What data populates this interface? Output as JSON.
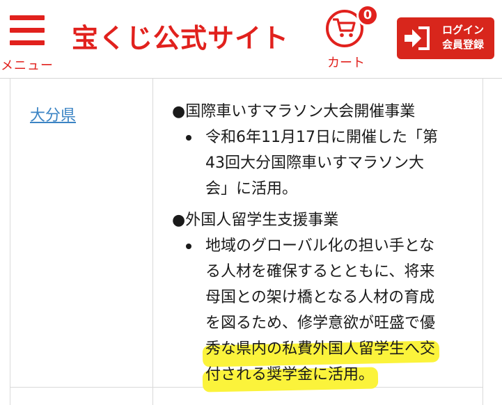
{
  "header": {
    "menu_label": "メニュー",
    "site_title": "宝くじ公式サイト",
    "cart_label": "カート",
    "cart_count": "0",
    "login_line1": "ログイン",
    "login_line2": "会員登録"
  },
  "row": {
    "prefecture": "大分県",
    "sections": [
      {
        "heading": "●国際車いすマラソン大会開催事業",
        "lines": [
          "令和6年11月17日に開催した「第",
          "43回大分国際車いすマラソン大",
          "会」に活用。"
        ]
      },
      {
        "heading": "●外国人留学生支援事業",
        "lines": [
          "地域のグローバル化の担い手とな",
          "る人材を確保するとともに、将来",
          "母国との架け橋となる人材の育成",
          "を図るため、修学意欲が旺盛で優",
          "秀な県内の私費外国人留学生へ交",
          "付される奨学金に活用。"
        ],
        "highlighted_lines": [
          4,
          5
        ]
      }
    ]
  },
  "colors": {
    "brand_red": "#e1211d",
    "link_blue": "#3b84c4",
    "highlight_yellow": "#fbf33b"
  },
  "icons": {
    "menu": "hamburger-icon",
    "cart": "shopping-cart-icon",
    "login": "login-arrow-icon"
  }
}
